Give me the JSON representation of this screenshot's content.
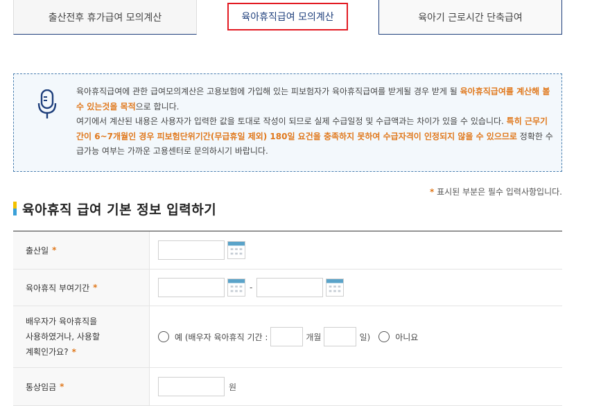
{
  "tabs": [
    {
      "label": "출산전후 휴가급여 모의계산"
    },
    {
      "label": "육아휴직급여 모의계산"
    },
    {
      "label": "육아기 근로시간 단축급여"
    }
  ],
  "notice": {
    "p1_normal": "육아휴직급여에 관한 급여모의계산은 고용보험에 가입해 있는 피보험자가 육아휴직급여를 받게될 경우 받게 될 ",
    "p1_highlight": "육아휴직급여를 계산해 볼 수 있는것을 목적",
    "p1_end": "으로 합니다.",
    "p2_normal": "여기에서 계산된 내용은 사용자가 입력한 값을 토대로 작성이 되므로 실제 수급일정 및 수급액과는 차이가 있을 수 있습니다. ",
    "p2_highlight": "특히 근무기간이 6~7개월인 경우 피보험단위기간(무급휴일 제외) 180일 요건을 충족하지 못하여 수급자격이 인정되지 않을 수 있으므로",
    "p2_end": " 정확한 수급가능 여부는 가까운 고용센터로 문의하시기 바랍니다."
  },
  "required_note": {
    "star": "*",
    "text": " 표시된 부분은 필수 입력사항입니다."
  },
  "section_title": "육아휴직 급여 기본 정보 입력하기",
  "form": {
    "birth_date_label": "출산일",
    "leave_period_label": "육아휴직 부여기간",
    "range_dash": "-",
    "spouse_label_l1": "배우자가 육아휴직을",
    "spouse_label_l2": "사용하였거나, 사용할",
    "spouse_label_l3": "계획인가요?",
    "yes_label": "예 (배우자 육아휴직 기간 :",
    "months_label": "개월",
    "days_label": "일)",
    "no_label": "아니요",
    "wage_label": "통상임금",
    "wage_unit": "원",
    "required_mark": "*"
  },
  "colors": {
    "accent": "#1d3e7b",
    "highlight": "#e0781c",
    "tab_active_border": "#e21a22",
    "notice_bg": "#f3f8fc"
  },
  "icons": {
    "notice": "microphone-icon",
    "calendar": "calendar-icon"
  }
}
